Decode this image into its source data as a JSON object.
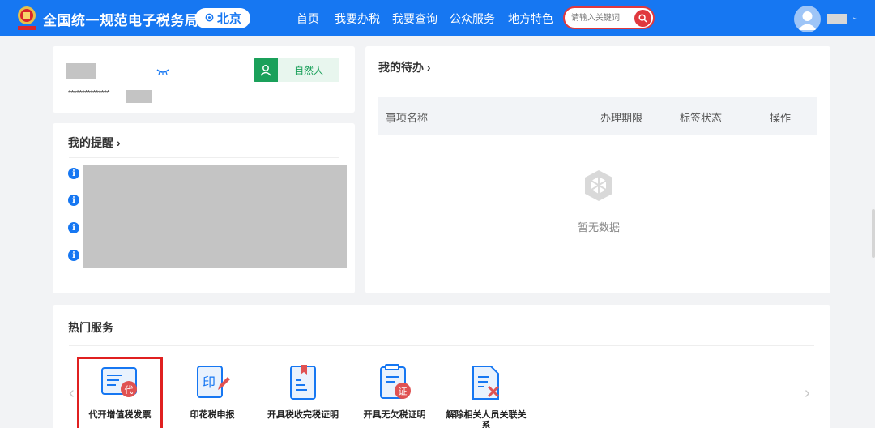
{
  "header": {
    "site_title": "全国统一规范电子税务局",
    "location": "北京",
    "nav": [
      "首页",
      "我要办税",
      "我要查询",
      "公众服务",
      "地方特色"
    ],
    "search_placeholder": "请输入关键词",
    "brand_color": "#1677f2",
    "accent_color": "#e0383e"
  },
  "user_card": {
    "masked_id": "***************",
    "role": "自然人"
  },
  "reminders": {
    "title": "我的提醒 ›",
    "item_count_icons": [
      "info-icon",
      "info-icon",
      "info-icon",
      "info-icon"
    ]
  },
  "todo": {
    "title": "我的待办 ›",
    "columns": [
      "事项名称",
      "办理期限",
      "标签状态",
      "操作"
    ],
    "empty_text": "暂无数据"
  },
  "hot_services": {
    "title": "热门服务",
    "items": [
      {
        "label": "代开增值税发票",
        "icon": "invoice-icon",
        "selected": true
      },
      {
        "label": "印花税申报",
        "icon": "stamp-edit-icon"
      },
      {
        "label": "开具税收完税证明",
        "icon": "document-bookmark-icon"
      },
      {
        "label": "开具无欠税证明",
        "icon": "certificate-icon"
      },
      {
        "label": "解除相关人员关联关系",
        "icon": "document-unlink-icon"
      }
    ]
  }
}
